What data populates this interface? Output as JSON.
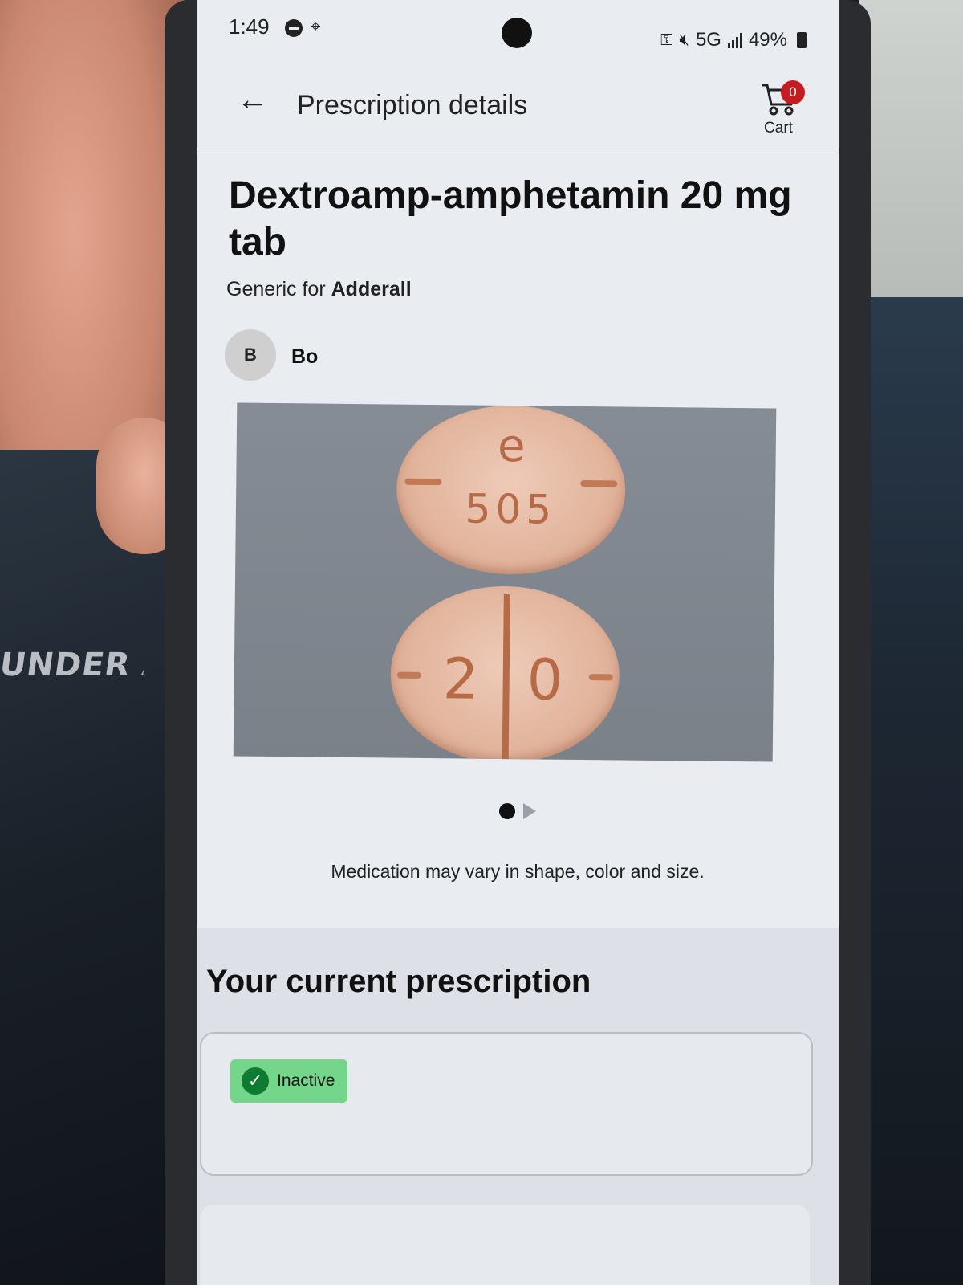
{
  "status_bar": {
    "time": "1:49",
    "network": "5G",
    "battery": "49%"
  },
  "app_bar": {
    "title": "Prescription details",
    "cart_label": "Cart",
    "cart_count": "0"
  },
  "drug": {
    "name": "Dextroamp-amphetamin 20 mg tab",
    "generic_prefix": "Generic for",
    "brand": "Adderall"
  },
  "patient": {
    "initial": "B",
    "name": "Bo"
  },
  "pill_image": {
    "imprint_top_letter": "e",
    "imprint_top_number": "505",
    "imprint_bottom_left": "2",
    "imprint_bottom_right": "0"
  },
  "carousel": {
    "total": 2,
    "current": 1
  },
  "disclaimer": "Medication may vary in shape, color and size.",
  "current_prescription": {
    "title": "Your current prescription",
    "status": "Inactive"
  },
  "background": {
    "brand_print": "UNDER ARM"
  },
  "icons": {
    "back": "arrow-left-icon",
    "cart": "cart-icon",
    "status": "check-circle-icon"
  },
  "colors": {
    "badge": "#c31d22",
    "status_bg": "#73d68a",
    "status_check": "#0f7a31"
  }
}
